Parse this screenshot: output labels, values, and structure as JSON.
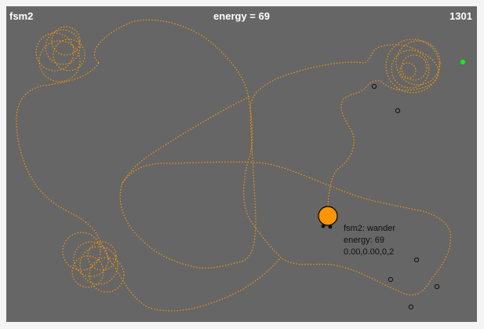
{
  "hud": {
    "mode": "fsm2",
    "energy_text": "energy = 69",
    "counter": "1301"
  },
  "agent": {
    "state_line": "fsm2: wander",
    "energy_line": "energy: 69",
    "vector_line": "0.00,0.00,0,2"
  },
  "colors": {
    "background": "#666666",
    "trail": "#ff9900",
    "agent": "#ff9500",
    "food": "#00ff00",
    "hud_text": "#ffffff"
  }
}
